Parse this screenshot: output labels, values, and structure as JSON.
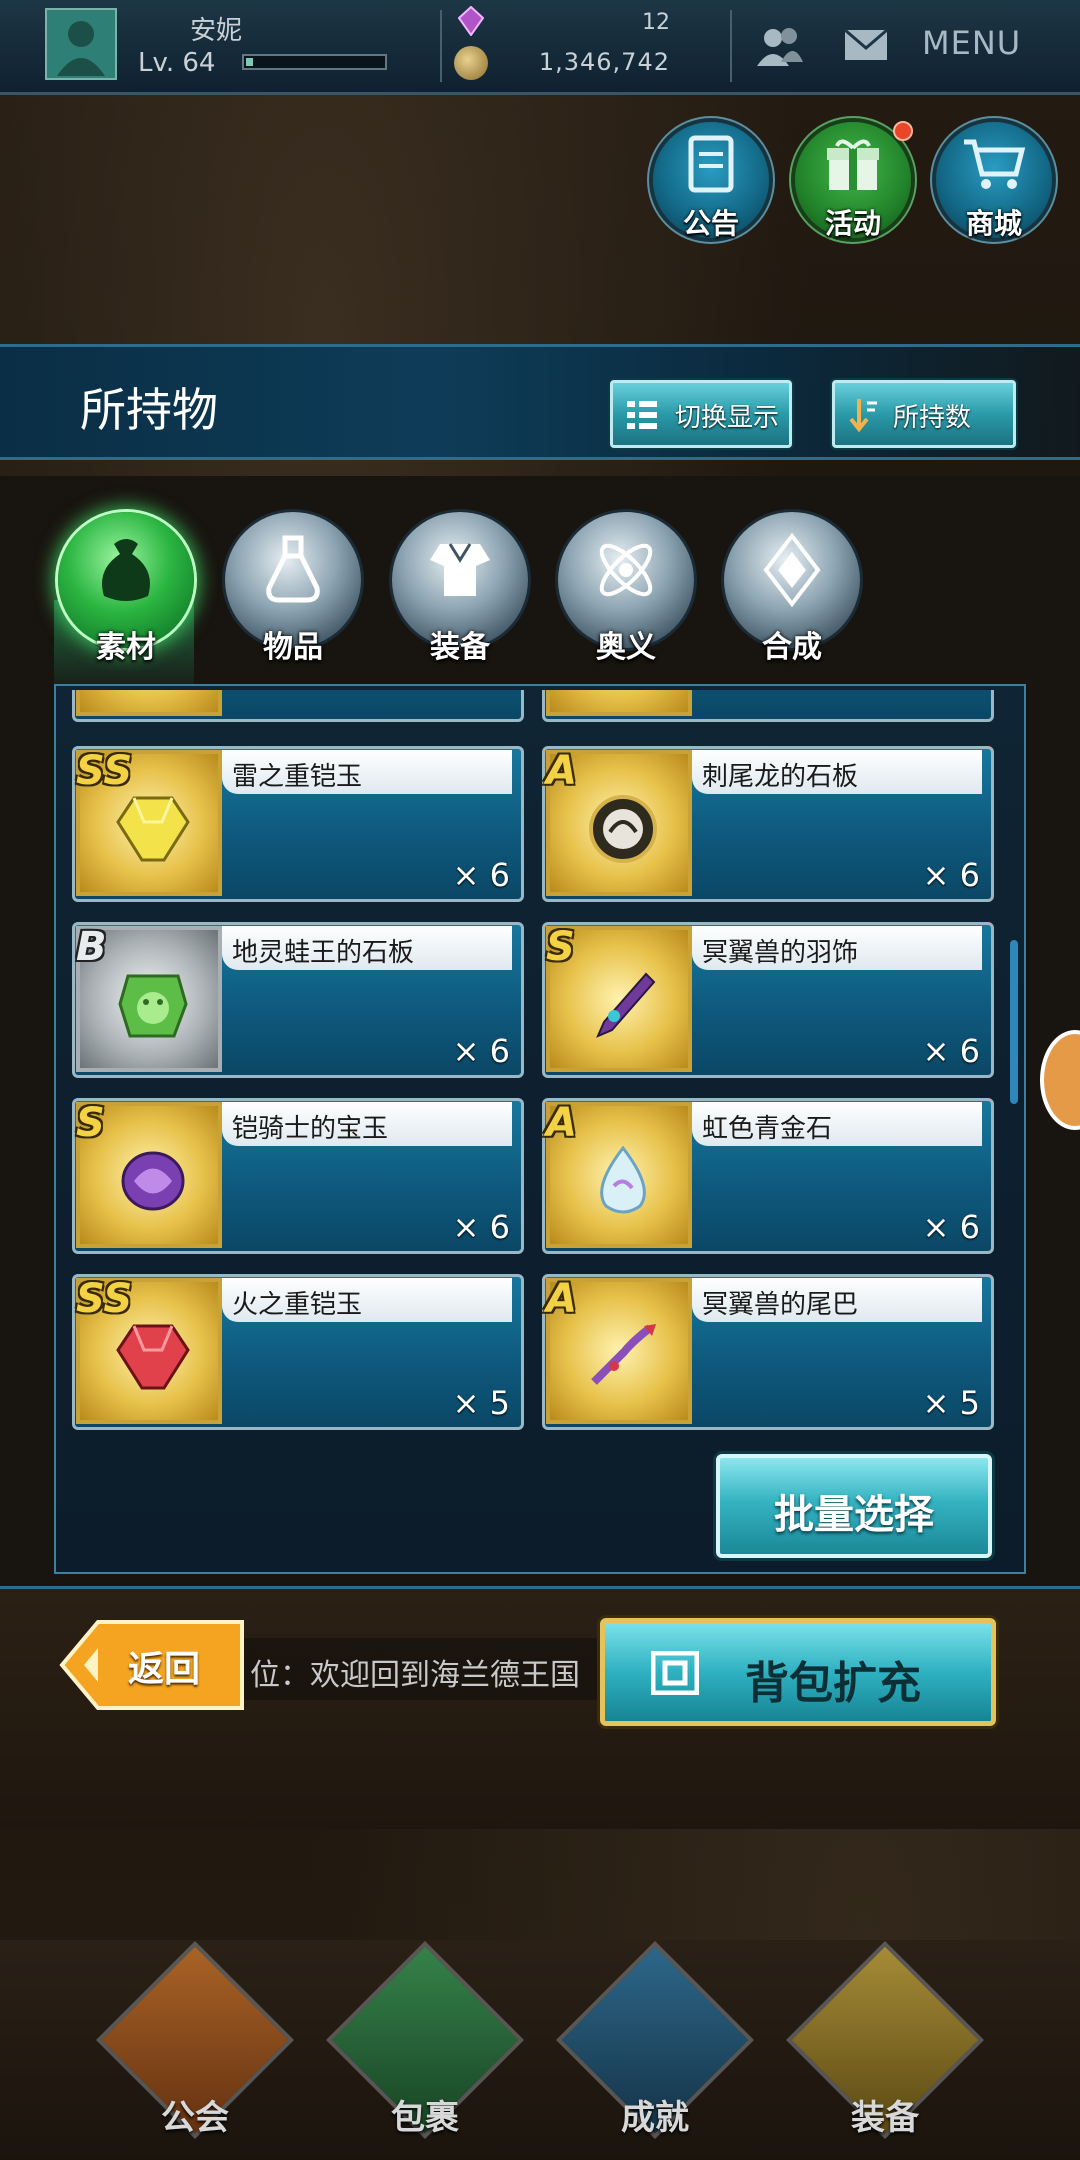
{
  "player": {
    "name": "安妮",
    "level": "Lv. 64",
    "exp_progress": 0.05,
    "gems": "12",
    "coins": "1,346,742"
  },
  "header_icons": {
    "friends": "friends-icon",
    "mail": "mail-icon",
    "menu_label": "MENU"
  },
  "top_buttons": [
    {
      "label": "公告",
      "icon": "notice-icon"
    },
    {
      "label": "活动",
      "icon": "gift-icon",
      "has_alert": true
    },
    {
      "label": "商城",
      "icon": "cart-icon"
    }
  ],
  "page": {
    "title": "所持物",
    "switch_view_label": "切换显示",
    "sort_label": "所持数"
  },
  "tabs": [
    {
      "label": "素材",
      "icon": "bag-icon",
      "selected": true
    },
    {
      "label": "物品",
      "icon": "potion-icon",
      "selected": false
    },
    {
      "label": "装备",
      "icon": "armor-icon",
      "selected": false
    },
    {
      "label": "奥义",
      "icon": "skill-icon",
      "selected": false
    },
    {
      "label": "合成",
      "icon": "synth-icon",
      "selected": false
    }
  ],
  "items": [
    {
      "rank": "SS",
      "name": "雷之重铠玉",
      "qty": "× 6",
      "icon": "yellow-gem-icon"
    },
    {
      "rank": "A",
      "name": "刺尾龙的石板",
      "qty": "× 6",
      "icon": "dragon-tablet-icon"
    },
    {
      "rank": "B",
      "name": "地灵蛙王的石板",
      "qty": "× 6",
      "icon": "frog-tablet-icon"
    },
    {
      "rank": "S",
      "name": "冥翼兽的羽饰",
      "qty": "× 6",
      "icon": "feather-ornament-icon"
    },
    {
      "rank": "S",
      "name": "铠骑士的宝玉",
      "qty": "× 6",
      "icon": "purple-jewel-icon"
    },
    {
      "rank": "A",
      "name": "虹色青金石",
      "qty": "× 6",
      "icon": "rainbow-stone-icon"
    },
    {
      "rank": "SS",
      "name": "火之重铠玉",
      "qty": "× 5",
      "icon": "red-gem-icon"
    },
    {
      "rank": "A",
      "name": "冥翼兽的尾巴",
      "qty": "× 5",
      "icon": "beast-tail-icon"
    }
  ],
  "batch_select_label": "批量选择",
  "bottom": {
    "back_label": "返回",
    "ticker": "位：欢迎回到海兰德王国",
    "expand_label": "背包扩充"
  },
  "nav": [
    {
      "label": "公会",
      "icon": "guild-icon"
    },
    {
      "label": "包裹",
      "icon": "bag-nav-icon"
    },
    {
      "label": "成就",
      "icon": "trophy-icon"
    },
    {
      "label": "装备",
      "icon": "equip-nav-icon"
    }
  ],
  "colors": {
    "accent": "#2fb1c1",
    "rank_gold": "#f4d245",
    "panel_border": "#3b7fa3"
  }
}
